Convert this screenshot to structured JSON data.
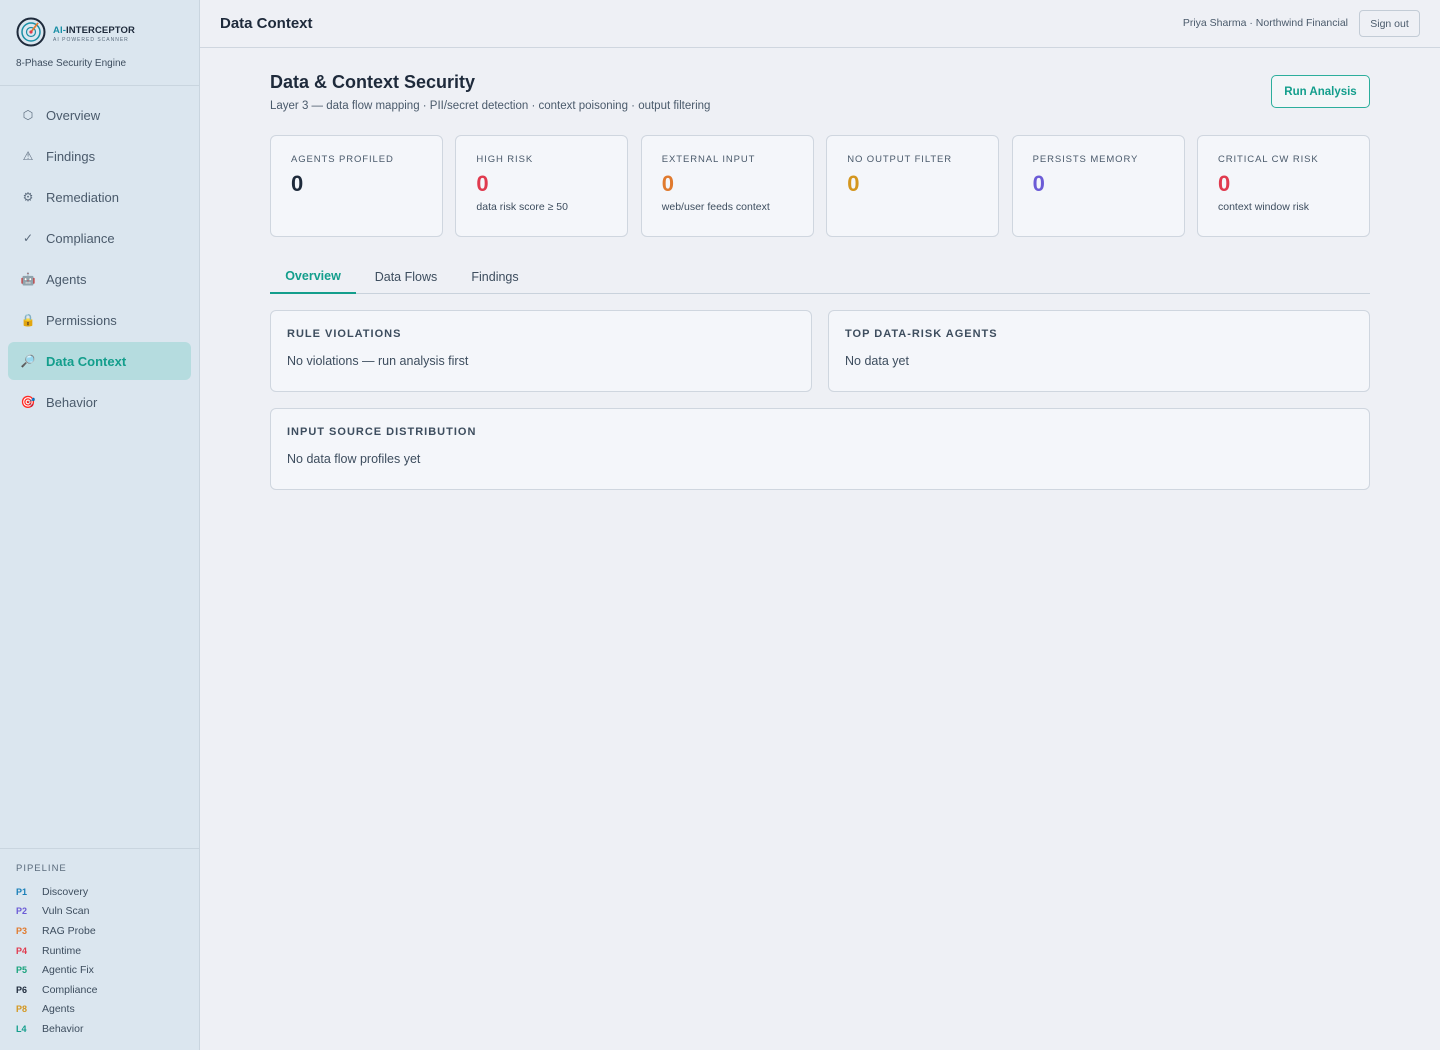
{
  "brand": {
    "name_prefix": "AI-",
    "name_main": "INTERCEPTOR",
    "tagline": "AI POWERED SCANNER",
    "engine": "8-Phase Security Engine"
  },
  "sidebar": {
    "items": [
      {
        "label": "Overview",
        "icon": "hexagon-icon",
        "glyph": "⬡"
      },
      {
        "label": "Findings",
        "icon": "warning-icon",
        "glyph": "⚠"
      },
      {
        "label": "Remediation",
        "icon": "gear-icon",
        "glyph": "⚙"
      },
      {
        "label": "Compliance",
        "icon": "check-icon",
        "glyph": "✓"
      },
      {
        "label": "Agents",
        "icon": "robot-icon",
        "glyph": "🤖"
      },
      {
        "label": "Permissions",
        "icon": "lock-icon",
        "glyph": "🔒"
      },
      {
        "label": "Data Context",
        "icon": "magnifier-icon",
        "glyph": "🔎"
      },
      {
        "label": "Behavior",
        "icon": "target-icon",
        "glyph": "🎯"
      }
    ],
    "active_index": 6
  },
  "pipeline": {
    "title": "PIPELINE",
    "steps": [
      {
        "code": "P1",
        "label": "Discovery",
        "color": "#1a7fb8"
      },
      {
        "code": "P2",
        "label": "Vuln Scan",
        "color": "#6b5bd6"
      },
      {
        "code": "P3",
        "label": "RAG Probe",
        "color": "#e07a2e"
      },
      {
        "code": "P4",
        "label": "Runtime",
        "color": "#e03a4e"
      },
      {
        "code": "P5",
        "label": "Agentic Fix",
        "color": "#18a37c"
      },
      {
        "code": "P6",
        "label": "Compliance",
        "color": "#1e2a3b"
      },
      {
        "code": "P8",
        "label": "Agents",
        "color": "#d4961e"
      },
      {
        "code": "L4",
        "label": "Behavior",
        "color": "#139e8c"
      }
    ]
  },
  "header": {
    "title": "Data Context",
    "user": "Priya Sharma · Northwind Financial",
    "signout_label": "Sign out"
  },
  "page": {
    "title": "Data & Context Security",
    "subtitle": "Layer 3 — data flow mapping · PII/secret detection · context poisoning · output filtering",
    "run_button": "Run Analysis"
  },
  "stats": [
    {
      "label": "AGENTS PROFILED",
      "value": "0",
      "note": "",
      "color": "#1e2a3b"
    },
    {
      "label": "HIGH RISK",
      "value": "0",
      "note": "data risk score ≥ 50",
      "color": "#e03a4e"
    },
    {
      "label": "EXTERNAL INPUT",
      "value": "0",
      "note": "web/user feeds context",
      "color": "#e07a2e"
    },
    {
      "label": "NO OUTPUT FILTER",
      "value": "0",
      "note": "",
      "color": "#d4961e"
    },
    {
      "label": "PERSISTS MEMORY",
      "value": "0",
      "note": "",
      "color": "#6b5bd6"
    },
    {
      "label": "CRITICAL CW RISK",
      "value": "0",
      "note": "context window risk",
      "color": "#e03a4e"
    }
  ],
  "tabs": [
    {
      "label": "Overview",
      "active": true
    },
    {
      "label": "Data Flows",
      "active": false
    },
    {
      "label": "Findings",
      "active": false
    }
  ],
  "panels": {
    "rule_violations": {
      "title": "RULE VIOLATIONS",
      "body": "No violations — run analysis first"
    },
    "top_agents": {
      "title": "TOP DATA-RISK AGENTS",
      "body": "No data yet"
    },
    "input_source": {
      "title": "INPUT SOURCE DISTRIBUTION",
      "body": "No data flow profiles yet"
    }
  }
}
